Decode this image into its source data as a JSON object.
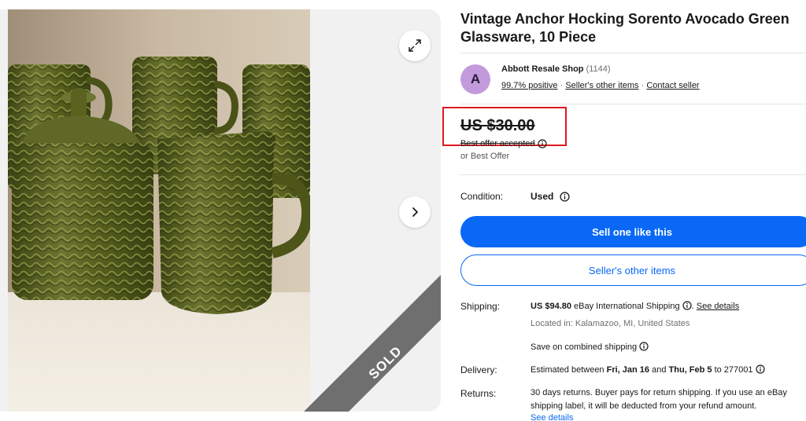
{
  "listing": {
    "title": "Vintage Anchor Hocking Sorento Avocado Green Glassware, 10 Piece",
    "image_alt": "Green glassware set: tumblers, sugar bowl and creamer pitcher",
    "sold_label": "SOLD"
  },
  "seller": {
    "avatar_letter": "A",
    "name": "Abbott Resale Shop",
    "feedback_count": "(1144)",
    "positive": "99.7% positive",
    "other_items": "Seller's other items",
    "contact": "Contact seller",
    "separator": "·"
  },
  "price": {
    "value": "US $30.00",
    "offer_status": "Best offer accepted",
    "or_best_offer": "or Best Offer"
  },
  "condition": {
    "label": "Condition:",
    "value": "Used"
  },
  "actions": {
    "sell_one": "Sell one like this",
    "seller_items": "Seller's other items"
  },
  "shipping": {
    "label": "Shipping:",
    "amount": "US $94.80",
    "method": " eBay International Shipping ",
    "see_details": "See details",
    "location": "Located in: Kalamazoo, MI, United States",
    "combined": "Save on combined shipping"
  },
  "delivery": {
    "label": "Delivery:",
    "prefix": "Estimated between ",
    "date_from": "Fri, Jan 16",
    "and": " and ",
    "date_to": "Thu, Feb 5",
    "suffix": " to 277001"
  },
  "returns": {
    "label": "Returns:",
    "line1": "30 days returns. Buyer pays for return shipping. If you use an eBay",
    "line2": "shipping label, it will be deducted from your refund amount.",
    "see_details": "See details"
  },
  "colors": {
    "primary_blue": "#0968f6",
    "highlight_red": "#e0191f",
    "avatar_purple": "#c39bdc"
  },
  "icons": {
    "expand": "expand-icon",
    "next": "chevron-right-icon",
    "info": "info-icon"
  }
}
